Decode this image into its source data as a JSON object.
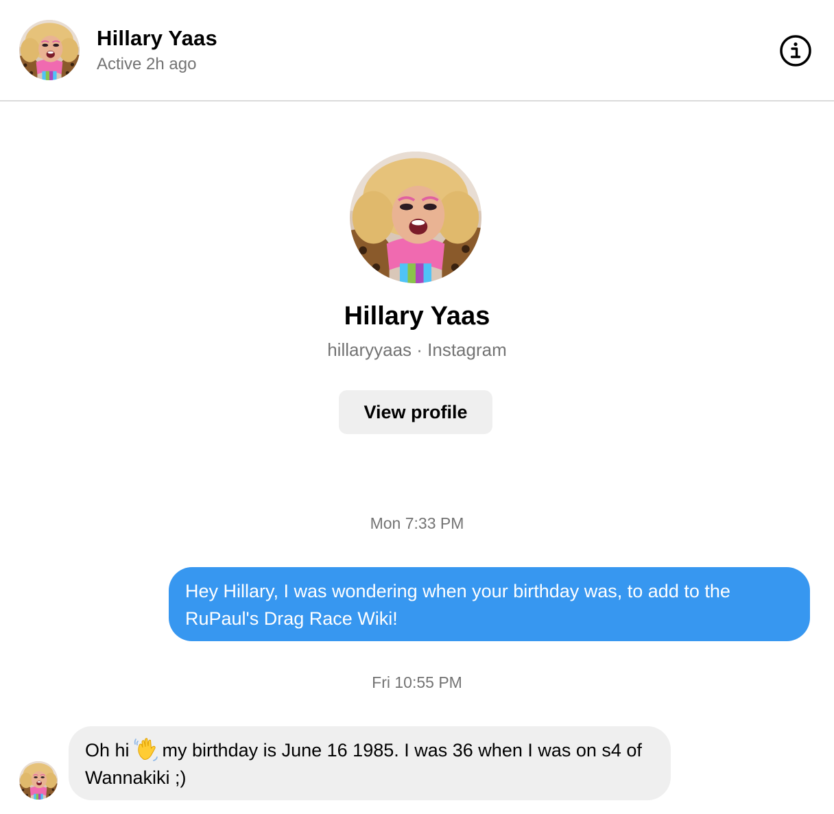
{
  "header": {
    "name": "Hillary Yaas",
    "status": "Active 2h ago",
    "avatar_icon": "user-avatar",
    "info_icon": "info-icon"
  },
  "profile": {
    "name": "Hillary Yaas",
    "subtitle": "hillaryyaas · Instagram",
    "view_profile_label": "View profile"
  },
  "thread": {
    "timestamps": [
      "Mon 7:33 PM",
      "Fri 10:55 PM"
    ],
    "messages": [
      {
        "direction": "outgoing",
        "text": "Hey Hillary, I was wondering when your birthday was, to add to the RuPaul's Drag Race Wiki!"
      },
      {
        "direction": "incoming",
        "text_before_emoji": "Oh hi",
        "emoji": "waving-hand",
        "text_after_emoji": "my birthday is June 16 1985. I was 36 when I was on s4 of Wannakiki ;)"
      }
    ]
  },
  "colors": {
    "outgoing_bubble": "#3797f0",
    "incoming_bubble": "#efefef",
    "secondary_text": "#737373",
    "divider": "#dbdbdb"
  }
}
